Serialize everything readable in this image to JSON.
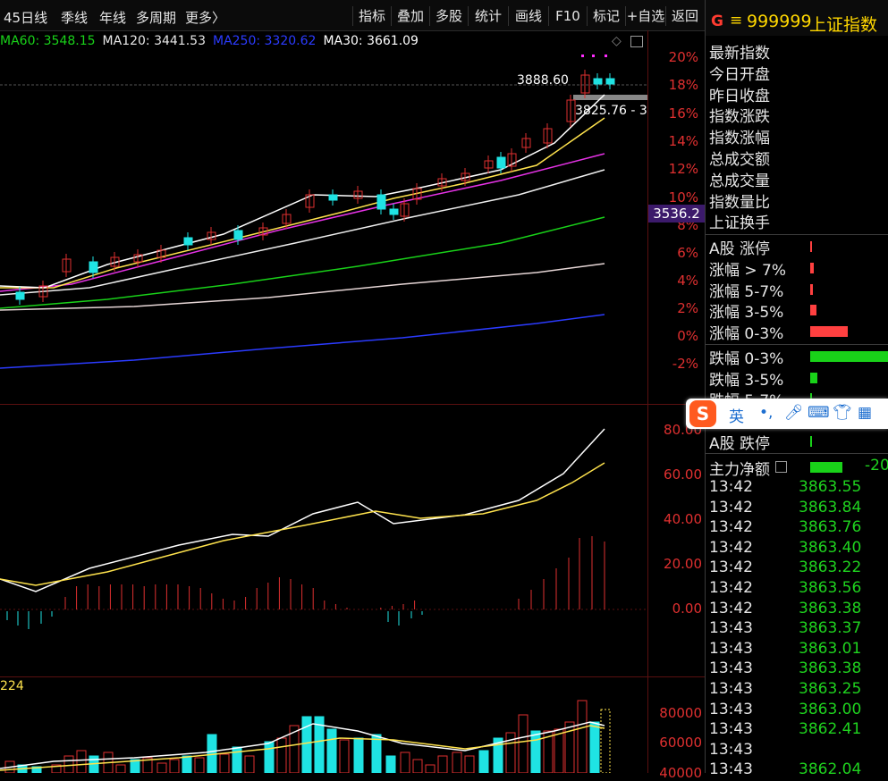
{
  "toolbar": {
    "period_tabs": [
      "45日线",
      "季线",
      "年线",
      "多周期",
      "更多〉"
    ],
    "buttons": [
      "指标",
      "叠加",
      "多股",
      "统计",
      "画线",
      "F10",
      "标记",
      "+自选",
      "返回"
    ]
  },
  "ma_legend": [
    {
      "label": "MA60: 3548.15",
      "color": "#19d219"
    },
    {
      "label": "MA120: 3441.53",
      "color": "#e6e6e6"
    },
    {
      "label": "MA250: 3320.62",
      "color": "#2b3bff"
    },
    {
      "label": "MA30: 3661.09",
      "color": "#ffffff"
    }
  ],
  "main_chart": {
    "pct_ticks": [
      "20%",
      "18%",
      "16%",
      "14%",
      "12%",
      "10%",
      "8%",
      "6%",
      "4%",
      "2%",
      "0%",
      "-2%"
    ],
    "price_label": "3536.2",
    "high_label": "3888.60",
    "low_label": "3825.76 - 3"
  },
  "macd_panel": {
    "ticks": [
      "80.00",
      "60.00",
      "40.00",
      "20.00",
      "0.00"
    ]
  },
  "volume_panel": {
    "label": "224",
    "ticks": [
      "80000",
      "60000",
      "40000"
    ]
  },
  "quote_header": {
    "code": "999999",
    "name": "上证指数",
    "badge": "G"
  },
  "quote_fields": [
    "最新指数",
    "今日开盘",
    "昨日收盘",
    "指数涨跌",
    "指数涨幅",
    "总成交额",
    "总成交量",
    "指数量比",
    "上证换手"
  ],
  "breadth": [
    {
      "label": "A股 涨停",
      "color": "#ff4040",
      "fraction": 0.02
    },
    {
      "label": "涨幅 > 7%",
      "color": "#ff4040",
      "fraction": 0.05
    },
    {
      "label": "涨幅 5-7%",
      "color": "#ff4040",
      "fraction": 0.03
    },
    {
      "label": "涨幅 3-5%",
      "color": "#ff4040",
      "fraction": 0.08
    },
    {
      "label": "涨幅 0-3%",
      "color": "#ff4040",
      "fraction": 0.48
    },
    {
      "label": "跌幅 0-3%",
      "color": "#19d219",
      "fraction": 1.0
    },
    {
      "label": "跌幅 3-5%",
      "color": "#19d219",
      "fraction": 0.09
    },
    {
      "label": "跌幅 5-7%",
      "color": "#19d219",
      "fraction": 0.01
    },
    {
      "label": "A股 跌停",
      "color": "#19d219",
      "fraction": 0.01
    }
  ],
  "main_force": {
    "label": "主力净额",
    "value": "-20"
  },
  "ime_bar": {
    "lang": "英",
    "punct": "•,"
  },
  "ticks": [
    {
      "time": "13:42",
      "price": "3863.55"
    },
    {
      "time": "13:42",
      "price": "3863.84"
    },
    {
      "time": "13:42",
      "price": "3863.76"
    },
    {
      "time": "13:42",
      "price": "3863.40"
    },
    {
      "time": "13:42",
      "price": "3863.22"
    },
    {
      "time": "13:42",
      "price": "3863.56"
    },
    {
      "time": "13:42",
      "price": "3863.38"
    },
    {
      "time": "13:43",
      "price": "3863.37"
    },
    {
      "time": "13:43",
      "price": "3863.01"
    },
    {
      "time": "13:43",
      "price": "3863.38"
    },
    {
      "time": "13:43",
      "price": "3863.25"
    },
    {
      "time": "13:43",
      "price": "3863.00"
    },
    {
      "time": "13:43",
      "price": "3862.41"
    },
    {
      "time": "13:43",
      "price": ""
    },
    {
      "time": "13:43",
      "price": "3862.04"
    }
  ]
}
